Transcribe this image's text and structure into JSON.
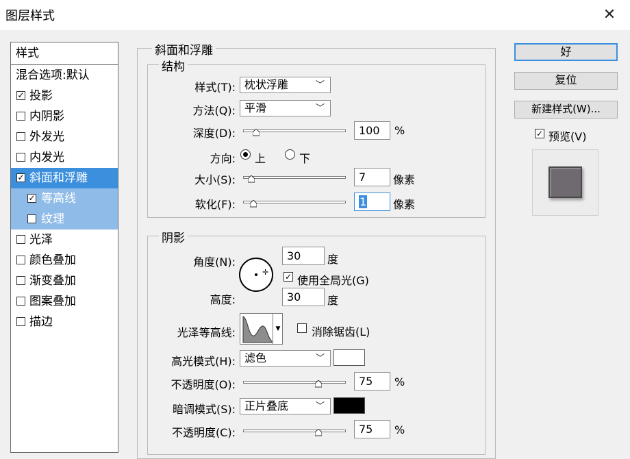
{
  "window": {
    "title": "图层样式",
    "close_glyph": "✕"
  },
  "left_list": {
    "header": "样式",
    "items": [
      {
        "label": "混合选项:默认",
        "checkbox": false,
        "checked": false,
        "state": "normal"
      },
      {
        "label": "投影",
        "checkbox": true,
        "checked": true,
        "state": "normal"
      },
      {
        "label": "内阴影",
        "checkbox": true,
        "checked": false,
        "state": "normal"
      },
      {
        "label": "外发光",
        "checkbox": true,
        "checked": false,
        "state": "normal"
      },
      {
        "label": "内发光",
        "checkbox": true,
        "checked": false,
        "state": "normal"
      },
      {
        "label": "斜面和浮雕",
        "checkbox": true,
        "checked": true,
        "state": "selected"
      },
      {
        "label": "等高线",
        "checkbox": true,
        "checked": true,
        "state": "sub"
      },
      {
        "label": "纹理",
        "checkbox": true,
        "checked": false,
        "state": "sub"
      },
      {
        "label": "光泽",
        "checkbox": true,
        "checked": false,
        "state": "normal"
      },
      {
        "label": "颜色叠加",
        "checkbox": true,
        "checked": false,
        "state": "normal"
      },
      {
        "label": "渐变叠加",
        "checkbox": true,
        "checked": false,
        "state": "normal"
      },
      {
        "label": "图案叠加",
        "checkbox": true,
        "checked": false,
        "state": "normal"
      },
      {
        "label": "描边",
        "checkbox": true,
        "checked": false,
        "state": "normal"
      }
    ]
  },
  "bevel": {
    "title": "斜面和浮雕",
    "structure": {
      "title": "结构",
      "style_label": "样式(T):",
      "style_value": "枕状浮雕",
      "technique_label": "方法(Q):",
      "technique_value": "平滑",
      "depth_label": "深度(D):",
      "depth_value": "100",
      "depth_unit": "%",
      "depth_fraction": 0.1,
      "direction_label": "方向:",
      "dir_up": "上",
      "dir_down": "下",
      "direction_selected": "上",
      "size_label": "大小(S):",
      "size_value": "7",
      "size_unit": "像素",
      "size_fraction": 0.05,
      "soften_label": "软化(F):",
      "soften_value": "1",
      "soften_unit": "像素",
      "soften_fraction": 0.07
    },
    "shading": {
      "title": "阴影",
      "angle_label": "角度(N):",
      "angle_value": "30",
      "angle_unit": "度",
      "global_light_label": "使用全局光(G)",
      "global_light_checked": true,
      "altitude_label": "高度:",
      "altitude_value": "30",
      "altitude_unit": "度",
      "gloss_label": "光泽等高线:",
      "antialias_label": "消除锯齿(L)",
      "antialias_checked": false,
      "highlight_mode_label": "高光模式(H):",
      "highlight_mode_value": "滤色",
      "highlight_color": "#ffffff",
      "highlight_opacity_label": "不透明度(O):",
      "highlight_opacity_value": "75",
      "highlight_opacity_unit": "%",
      "highlight_opacity_fraction": 0.75,
      "shadow_mode_label": "暗调模式(S):",
      "shadow_mode_value": "正片叠底",
      "shadow_color": "#000000",
      "shadow_opacity_label": "不透明度(C):",
      "shadow_opacity_value": "75",
      "shadow_opacity_unit": "%",
      "shadow_opacity_fraction": 0.75
    }
  },
  "buttons": {
    "ok": "好",
    "reset": "复位",
    "new_style": "新建样式(W)...",
    "preview_label": "预览(V)",
    "preview_checked": true
  },
  "colors": {
    "selected_row": "#3c8fdd",
    "sub_row": "#8fbbe8",
    "preview_swatch": "#6e6a70"
  }
}
